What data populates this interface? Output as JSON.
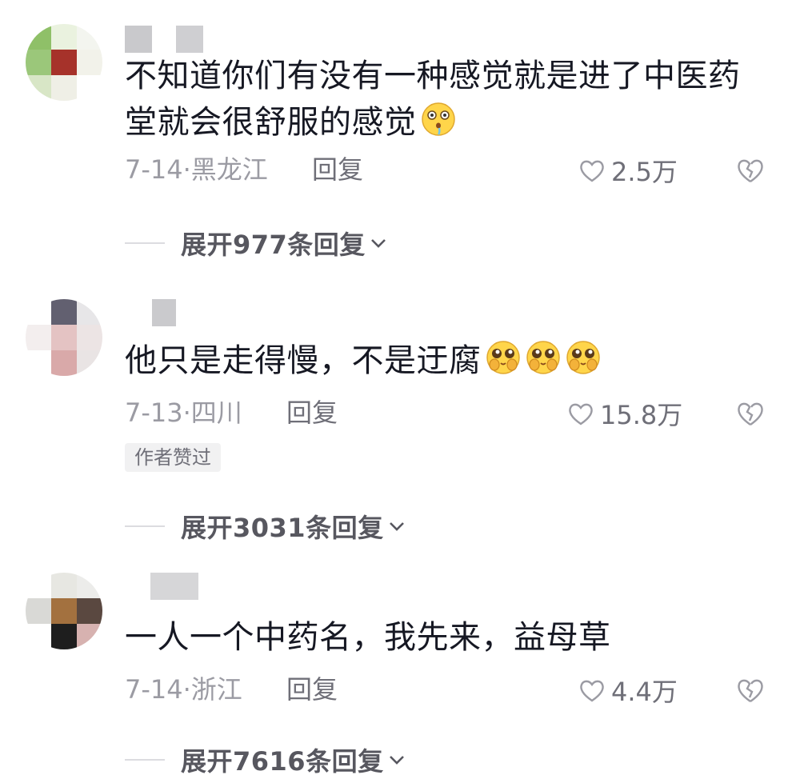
{
  "comments": [
    {
      "text": "不知道你们有没有一种感觉就是进了中医药堂就会很舒服的感觉",
      "emoji": "drooling-face-icon",
      "date": "7-14",
      "location": "黑龙江",
      "separator": "·",
      "reply_label": "回复",
      "likes": "2.5万",
      "author_liked": "",
      "expand_label": "展开977条回复"
    },
    {
      "text": "他只是走得慢，不是迂腐",
      "emoji": "pleading-face-icon",
      "emoji_count": 3,
      "date": "7-13",
      "location": "四川",
      "separator": "·",
      "reply_label": "回复",
      "likes": "15.8万",
      "author_liked": "作者赞过",
      "expand_label": "展开3031条回复"
    },
    {
      "text": "一人一个中药名，我先来，益母草",
      "date": "7-14",
      "location": "浙江",
      "separator": "·",
      "reply_label": "回复",
      "likes": "4.4万",
      "author_liked": "",
      "expand_label": "展开7616条回复"
    }
  ],
  "colors": {
    "text": "#161823",
    "meta": "#9b9ba3",
    "expand": "#57575f"
  }
}
